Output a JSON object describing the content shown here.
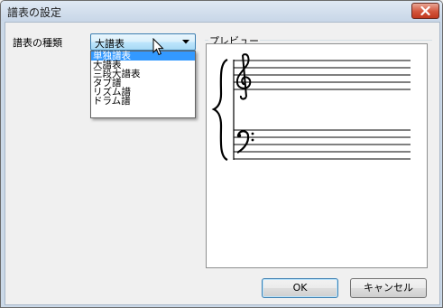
{
  "window": {
    "title": "譜表の設定"
  },
  "form": {
    "staff_type_label": "譜表の種類",
    "staff_type_value": "大譜表",
    "options": [
      "単独譜表",
      "大譜表",
      "三段大譜表",
      "タブ譜",
      "リズム譜",
      "ドラム譜"
    ],
    "highlighted_option": "単独譜表"
  },
  "preview": {
    "label": "プレビュー"
  },
  "buttons": {
    "ok": "OK",
    "cancel": "キャンセル"
  },
  "colors": {
    "highlight": "#3399ff",
    "close_button": "#c0391f"
  },
  "icons": [
    "close-icon",
    "dropdown-arrow-icon",
    "mouse-cursor-icon",
    "treble-clef-icon",
    "bass-clef-icon",
    "brace-icon"
  ]
}
